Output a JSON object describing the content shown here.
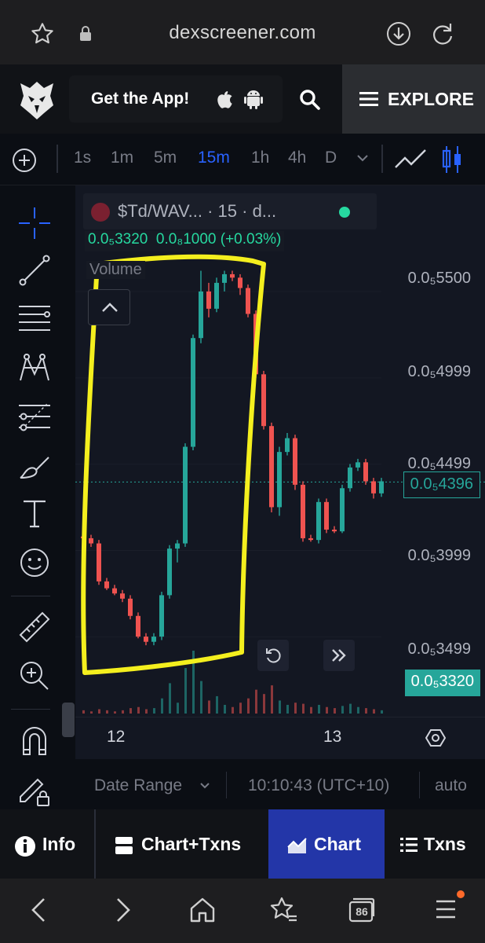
{
  "browser": {
    "url": "dexscreener.com",
    "tab_count": "86"
  },
  "header": {
    "get_app_label": "Get the App!",
    "explore_label": "EXPLORE"
  },
  "toolbar": {
    "intervals": [
      "1s",
      "1m",
      "5m",
      "15m",
      "1h",
      "4h",
      "D"
    ],
    "active_interval": "15m"
  },
  "legend": {
    "symbol": "$Td/WAV... · 15 · d...",
    "open": "0.0₅3320",
    "change": "0.0₈1000 (+0.03%)",
    "volume_label": "Volume"
  },
  "price_axis": {
    "labels": [
      "0.0₅5500",
      "0.0₅4999",
      "0.0₅4499",
      "0.0₅3999",
      "0.0₅3499"
    ],
    "current_price": "0.0₅4396",
    "last_price": "0.0₅3320"
  },
  "time_axis": {
    "labels": [
      "12",
      "13"
    ]
  },
  "status": {
    "date_range_label": "Date Range",
    "time": "10:10:43 (UTC+10)",
    "scale_mode": "auto"
  },
  "tabs": {
    "info": "Info",
    "chart_txns": "Chart+Txns",
    "chart": "Chart",
    "txns": "Txns",
    "active": "Chart"
  },
  "colors": {
    "up": "#26a69a",
    "down": "#ef5350",
    "accent": "#2962ff",
    "highlight": "#f4ef1e",
    "active_tab": "#2336a8"
  },
  "chart_data": {
    "type": "candlestick",
    "price_scale": "0.0₅ (×1e-5)",
    "ylim": [
      3.2,
      5.75
    ],
    "candles": [
      {
        "o": 4.08,
        "h": 4.1,
        "l": 4.05,
        "c": 4.07
      },
      {
        "o": 4.07,
        "h": 4.09,
        "l": 4.02,
        "c": 4.04
      },
      {
        "o": 4.04,
        "h": 4.06,
        "l": 3.8,
        "c": 3.82
      },
      {
        "o": 3.82,
        "h": 3.84,
        "l": 3.77,
        "c": 3.78
      },
      {
        "o": 3.78,
        "h": 3.8,
        "l": 3.74,
        "c": 3.75
      },
      {
        "o": 3.75,
        "h": 3.77,
        "l": 3.7,
        "c": 3.72
      },
      {
        "o": 3.72,
        "h": 3.74,
        "l": 3.6,
        "c": 3.62
      },
      {
        "o": 3.62,
        "h": 3.64,
        "l": 3.49,
        "c": 3.5
      },
      {
        "o": 3.5,
        "h": 3.52,
        "l": 3.45,
        "c": 3.47
      },
      {
        "o": 3.47,
        "h": 3.52,
        "l": 3.45,
        "c": 3.5
      },
      {
        "o": 3.5,
        "h": 3.76,
        "l": 3.48,
        "c": 3.74
      },
      {
        "o": 3.74,
        "h": 4.03,
        "l": 3.72,
        "c": 4.01
      },
      {
        "o": 4.01,
        "h": 4.06,
        "l": 3.93,
        "c": 4.04
      },
      {
        "o": 4.04,
        "h": 4.62,
        "l": 4.02,
        "c": 4.6
      },
      {
        "o": 4.6,
        "h": 5.25,
        "l": 4.58,
        "c": 5.23
      },
      {
        "o": 5.23,
        "h": 5.62,
        "l": 5.2,
        "c": 5.5
      },
      {
        "o": 5.5,
        "h": 5.55,
        "l": 5.35,
        "c": 5.4
      },
      {
        "o": 5.4,
        "h": 5.58,
        "l": 5.38,
        "c": 5.55
      },
      {
        "o": 5.55,
        "h": 5.62,
        "l": 5.5,
        "c": 5.6
      },
      {
        "o": 5.6,
        "h": 5.62,
        "l": 5.56,
        "c": 5.58
      },
      {
        "o": 5.58,
        "h": 5.6,
        "l": 5.48,
        "c": 5.52
      },
      {
        "o": 5.52,
        "h": 5.54,
        "l": 5.35,
        "c": 5.37
      },
      {
        "o": 5.37,
        "h": 5.39,
        "l": 5.0,
        "c": 5.02
      },
      {
        "o": 5.02,
        "h": 5.04,
        "l": 4.7,
        "c": 4.72
      },
      {
        "o": 4.72,
        "h": 4.74,
        "l": 4.22,
        "c": 4.25
      },
      {
        "o": 4.25,
        "h": 4.6,
        "l": 4.2,
        "c": 4.57
      },
      {
        "o": 4.57,
        "h": 4.68,
        "l": 4.55,
        "c": 4.65
      },
      {
        "o": 4.65,
        "h": 4.67,
        "l": 4.35,
        "c": 4.38
      },
      {
        "o": 4.38,
        "h": 4.4,
        "l": 4.05,
        "c": 4.07
      },
      {
        "o": 4.07,
        "h": 4.09,
        "l": 4.05,
        "c": 4.06
      },
      {
        "o": 4.06,
        "h": 4.3,
        "l": 4.04,
        "c": 4.28
      },
      {
        "o": 4.28,
        "h": 4.3,
        "l": 4.1,
        "c": 4.12
      },
      {
        "o": 4.12,
        "h": 4.14,
        "l": 4.1,
        "c": 4.11
      },
      {
        "o": 4.11,
        "h": 4.38,
        "l": 4.1,
        "c": 4.36
      },
      {
        "o": 4.36,
        "h": 4.5,
        "l": 4.34,
        "c": 4.48
      },
      {
        "o": 4.48,
        "h": 4.53,
        "l": 4.46,
        "c": 4.51
      },
      {
        "o": 4.51,
        "h": 4.53,
        "l": 4.38,
        "c": 4.4
      },
      {
        "o": 4.4,
        "h": 4.42,
        "l": 4.3,
        "c": 4.33
      },
      {
        "o": 4.33,
        "h": 4.42,
        "l": 4.31,
        "c": 4.4
      }
    ],
    "volumes": [
      3,
      2,
      4,
      3,
      2,
      3,
      5,
      6,
      4,
      5,
      14,
      28,
      10,
      42,
      58,
      30,
      12,
      16,
      8,
      6,
      10,
      14,
      22,
      18,
      26,
      12,
      8,
      10,
      9,
      6,
      8,
      6,
      5,
      7,
      9,
      6,
      5,
      4,
      3
    ]
  }
}
